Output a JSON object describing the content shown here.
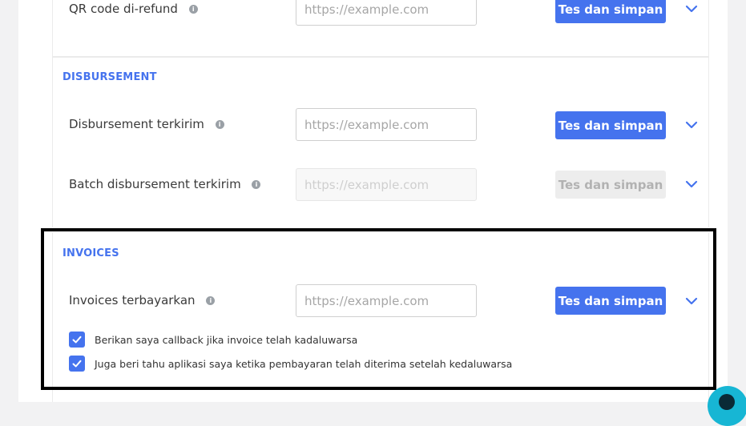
{
  "rows": {
    "qr_refund": {
      "label": "QR code di-refund",
      "placeholder": "https://example.com",
      "button": "Tes dan simpan"
    },
    "disbursement_sent": {
      "label": "Disbursement terkirim",
      "placeholder": "https://example.com",
      "button": "Tes dan simpan"
    },
    "batch_disbursement_sent": {
      "label": "Batch disbursement terkirim",
      "placeholder": "https://example.com",
      "button": "Tes dan simpan",
      "disabled": true
    },
    "invoices_paid": {
      "label": "Invoices terbayarkan",
      "placeholder": "https://example.com",
      "button": "Tes dan simpan"
    }
  },
  "sections": {
    "disbursement": "DISBURSEMENT",
    "invoices": "INVOICES"
  },
  "checkboxes": [
    {
      "label": "Berikan saya callback jika invoice telah kadaluwarsa",
      "checked": true
    },
    {
      "label": "Juga beri tahu aplikasi saya ketika pembayaran telah diterima setelah kedaluwarsa",
      "checked": true
    }
  ],
  "icons": {
    "info": "info-icon",
    "expand": "chevron-down-icon",
    "check": "checkmark-icon",
    "help": "help-chat-icon"
  },
  "colors": {
    "accent": "#4573ee",
    "disabled_button": "#ededed",
    "highlight_border": "#000000",
    "help_bubble": "#17b6d4"
  }
}
